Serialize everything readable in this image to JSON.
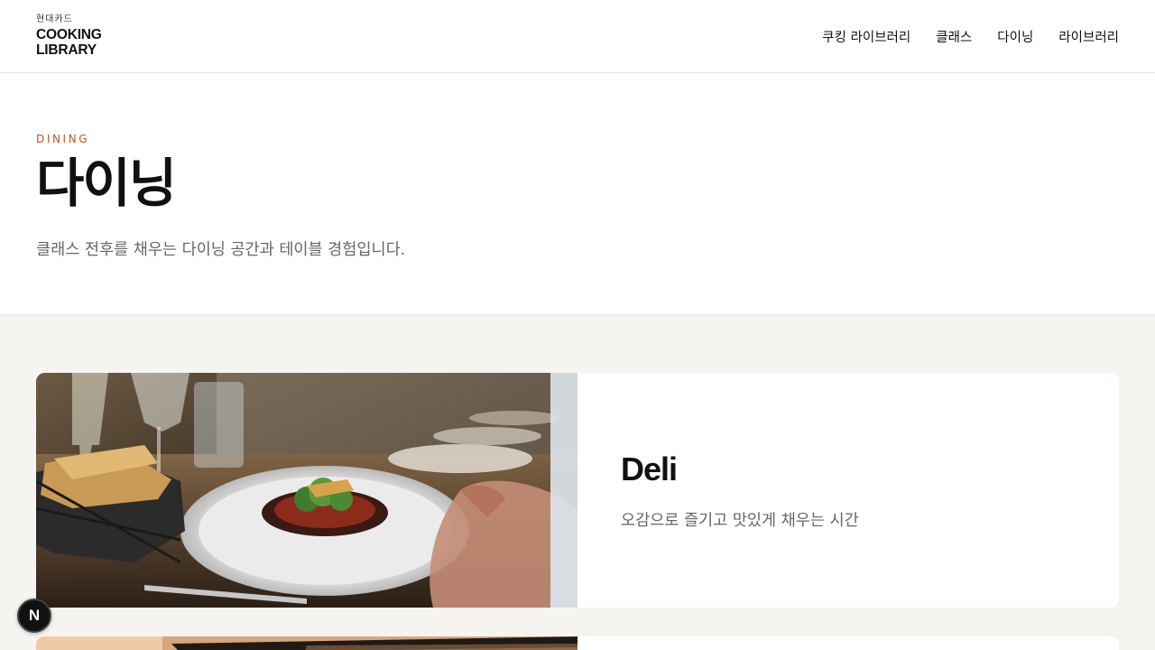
{
  "header": {
    "logo_small": "현대카드",
    "logo_line1": "COOKING",
    "logo_line2": "LIBRARY",
    "nav": [
      {
        "label": "쿠킹 라이브러리"
      },
      {
        "label": "클래스"
      },
      {
        "label": "다이닝"
      },
      {
        "label": "라이브러리"
      }
    ]
  },
  "hero": {
    "eyebrow": "DINING",
    "title": "다이닝",
    "subtitle": "클래스 전후를 채우는 다이닝 공간과 테이블 경험입니다."
  },
  "cards": [
    {
      "title": "Deli",
      "description": "오감으로 즐기고 맛있게 채우는 시간"
    }
  ],
  "badge": {
    "label": "N"
  },
  "colors": {
    "accent": "#c0531c",
    "background_section": "#f5f4f1"
  }
}
